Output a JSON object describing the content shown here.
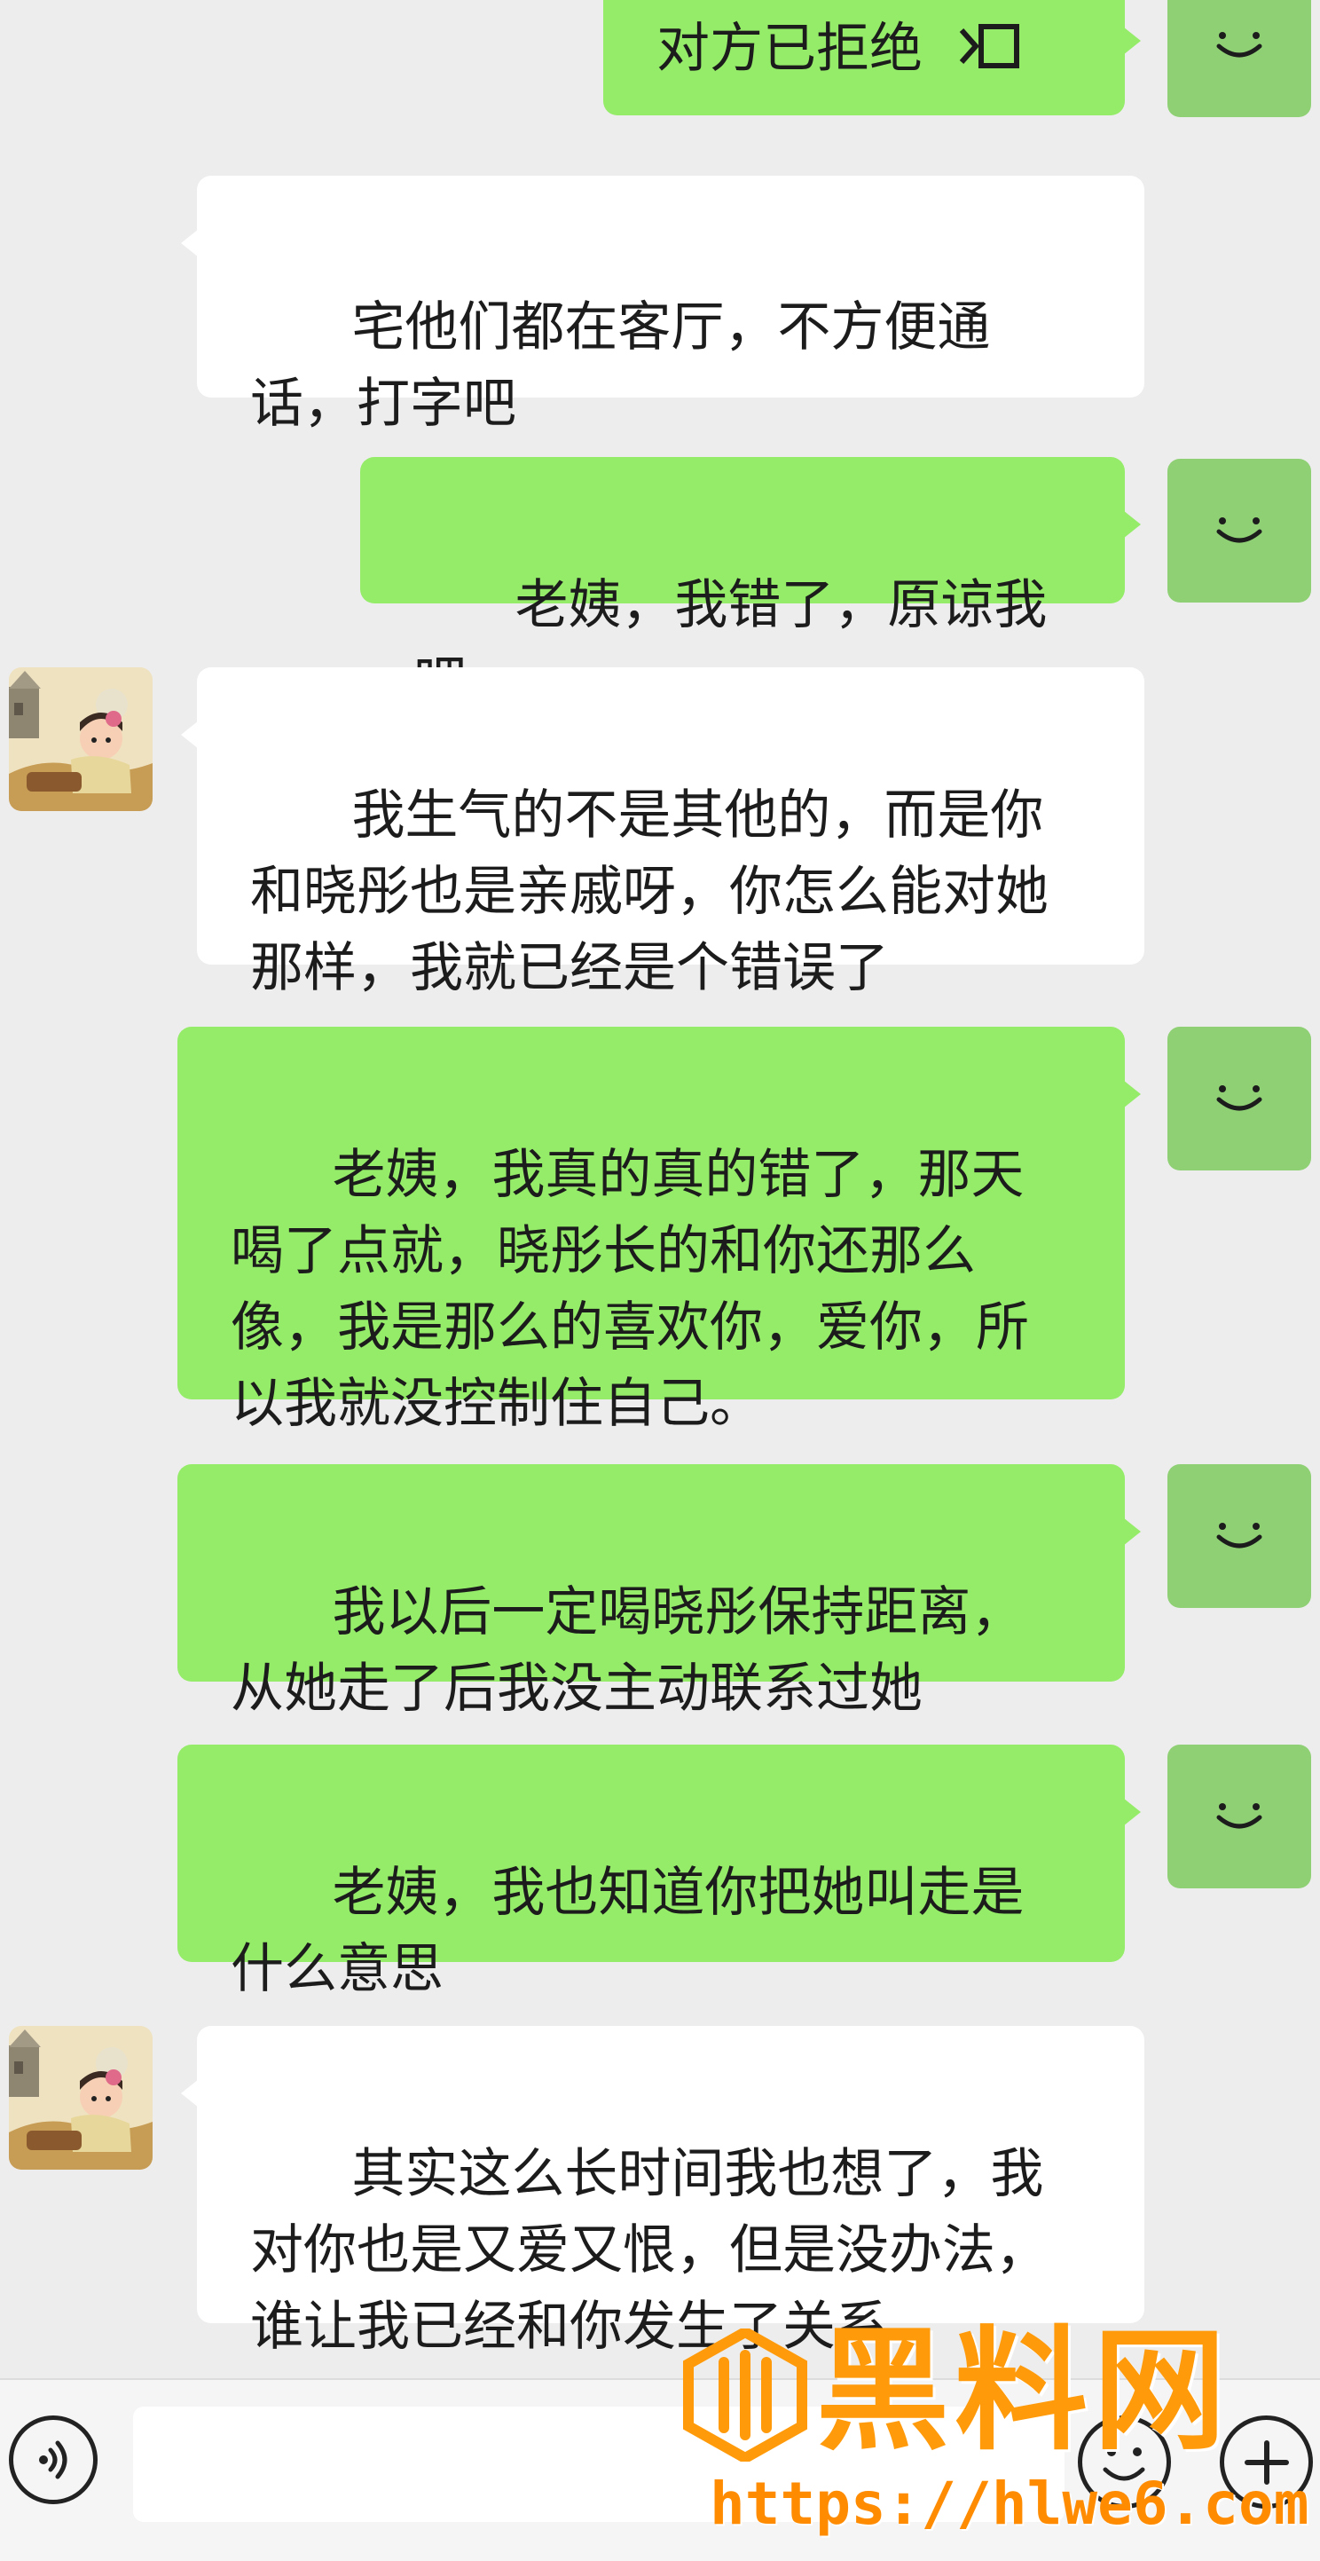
{
  "messages": [
    {
      "sender": "me",
      "text": "对方已拒绝",
      "type": "call"
    },
    {
      "sender": "her",
      "text": "宅他们都在客厅，不方便通话，打字吧",
      "type": "text"
    },
    {
      "sender": "me",
      "text": "老姨，我错了，原谅我吧",
      "type": "text"
    },
    {
      "sender": "her",
      "text": "我生气的不是其他的，而是你和晓彤也是亲戚呀，你怎么能对她那样，我就已经是个错误了",
      "type": "text"
    },
    {
      "sender": "me",
      "text": "老姨，我真的真的错了，那天喝了点就，晓彤长的和你还那么像，我是那么的喜欢你，爱你，所以我就没控制住自己。",
      "type": "text"
    },
    {
      "sender": "me",
      "text": "我以后一定喝晓彤保持距离，从她走了后我没主动联系过她",
      "type": "text"
    },
    {
      "sender": "me",
      "text": "老姨，我也知道你把她叫走是什么意思",
      "type": "text"
    },
    {
      "sender": "her",
      "text": "其实这么长时间我也想了，我对你也是又爱又恨，但是没办法，谁让我已经和你发生了关系",
      "type": "text"
    }
  ],
  "watermark": {
    "name": "黑料网",
    "url": "https://hlwe6.com"
  },
  "icons": {
    "my_avatar": "smile-face-icon",
    "her_avatar": "cartoon-girl-avatar",
    "call": "video-call-icon",
    "voice": "voice-icon",
    "emoji": "emoji-icon",
    "plus": "plus-icon"
  },
  "colors": {
    "my_bubble": "#95ec69",
    "her_bubble": "#ffffff",
    "my_avatar_bg": "#8fd075",
    "background": "#ededed",
    "watermark": "#ff9a0a"
  }
}
